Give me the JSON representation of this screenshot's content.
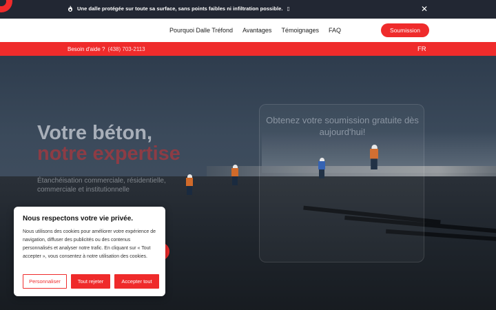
{
  "announcement": {
    "icon": "fire-icon",
    "text": "Une dalle protégée sur toute sa surface, sans points faibles ni infiltration possible. ",
    "trailing_glyph": "▯",
    "close_icon": "close-icon"
  },
  "nav": {
    "items": [
      {
        "label": "Pourquoi Dalle Tréfond"
      },
      {
        "label": "Avantages"
      },
      {
        "label": "Témoignages"
      },
      {
        "label": "FAQ"
      }
    ],
    "cta_label": "Soumission"
  },
  "helpbar": {
    "label": "Besoin d'aide ?",
    "phone": "(438) 703-2113",
    "lang": "FR"
  },
  "hero": {
    "title_line1": "Votre béton,",
    "title_line2": "notre expertise",
    "subtitle": "Étanchéisation commerciale, résidentielle, commerciale et institutionnelle",
    "quote_title": "Obtenez votre soumission gratuite dès aujourd'hui!"
  },
  "cookie": {
    "title": "Nous respectons votre vie privée.",
    "body": "Nous utilisons des cookies pour améliorer votre expérience de navigation, diffuser des publicités ou des contenus personnalisés et analyser notre trafic. En cliquant sur « Tout accepter », vous consentez à notre utilisation des cookies.",
    "btn_customize": "Personnaliser",
    "btn_reject": "Tout rejeter",
    "btn_accept": "Accepter tout"
  },
  "colors": {
    "brand_red": "#ef2b2b",
    "dark_bar": "#222733"
  }
}
